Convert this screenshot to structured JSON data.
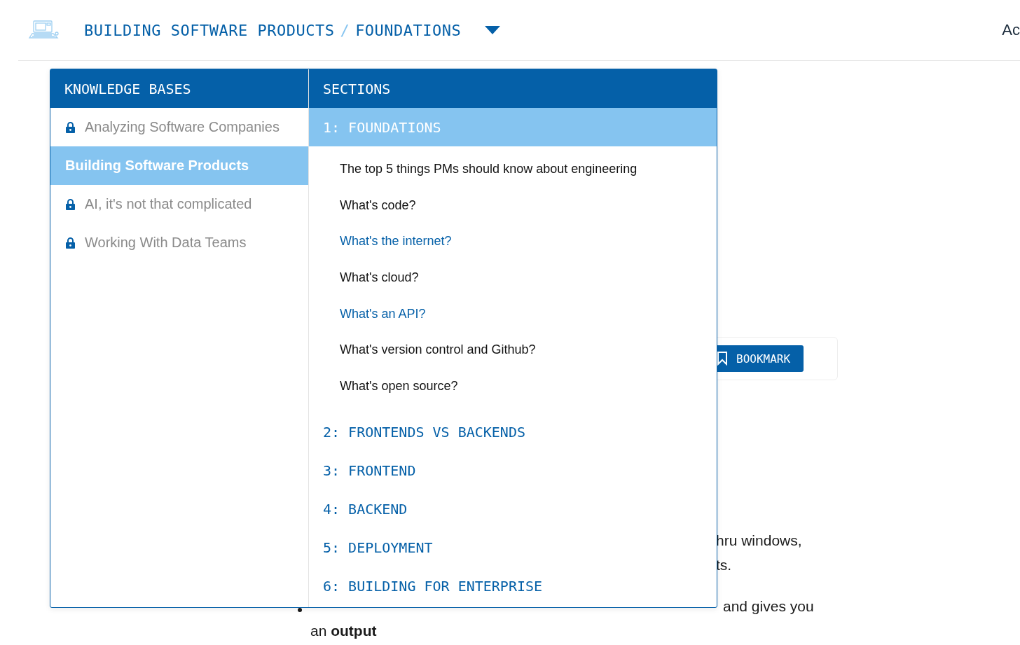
{
  "header": {
    "breadcrumb": [
      {
        "label": "BUILDING SOFTWARE PRODUCTS"
      },
      {
        "label": "FOUNDATIONS"
      }
    ],
    "separator": "/",
    "account_link": "Ac"
  },
  "dropdown": {
    "knowledge_bases": {
      "title": "KNOWLEDGE BASES",
      "items": [
        {
          "label": "Analyzing Software Companies",
          "locked": true,
          "selected": false
        },
        {
          "label": "Building Software Products",
          "locked": false,
          "selected": true
        },
        {
          "label": "AI, it's not that complicated",
          "locked": true,
          "selected": false
        },
        {
          "label": "Working With Data Teams",
          "locked": true,
          "selected": false
        }
      ]
    },
    "sections": {
      "title": "SECTIONS",
      "items": [
        {
          "label": "1: FOUNDATIONS",
          "selected": true,
          "children": [
            {
              "label": "The top 5 things PMs should know about engineering",
              "visited": false
            },
            {
              "label": "What's code?",
              "visited": false
            },
            {
              "label": "What's the internet?",
              "visited": true
            },
            {
              "label": "What's cloud?",
              "visited": false
            },
            {
              "label": "What's an API?",
              "visited": true
            },
            {
              "label": "What's version control and Github?",
              "visited": false
            },
            {
              "label": "What's open source?",
              "visited": false
            }
          ]
        },
        {
          "label": "2: FRONTENDS VS BACKENDS",
          "selected": false
        },
        {
          "label": "3: FRONTEND",
          "selected": false
        },
        {
          "label": "4: BACKEND",
          "selected": false
        },
        {
          "label": "5: DEPLOYMENT",
          "selected": false
        },
        {
          "label": "6: BUILDING FOR ENTERPRISE",
          "selected": false
        }
      ]
    }
  },
  "article": {
    "bookmark_button": "BOOKMARK",
    "fragments": [
      "hru windows,",
      "ts."
    ],
    "bullet_tail": "and gives you",
    "bullet_end": "an **output**"
  }
}
